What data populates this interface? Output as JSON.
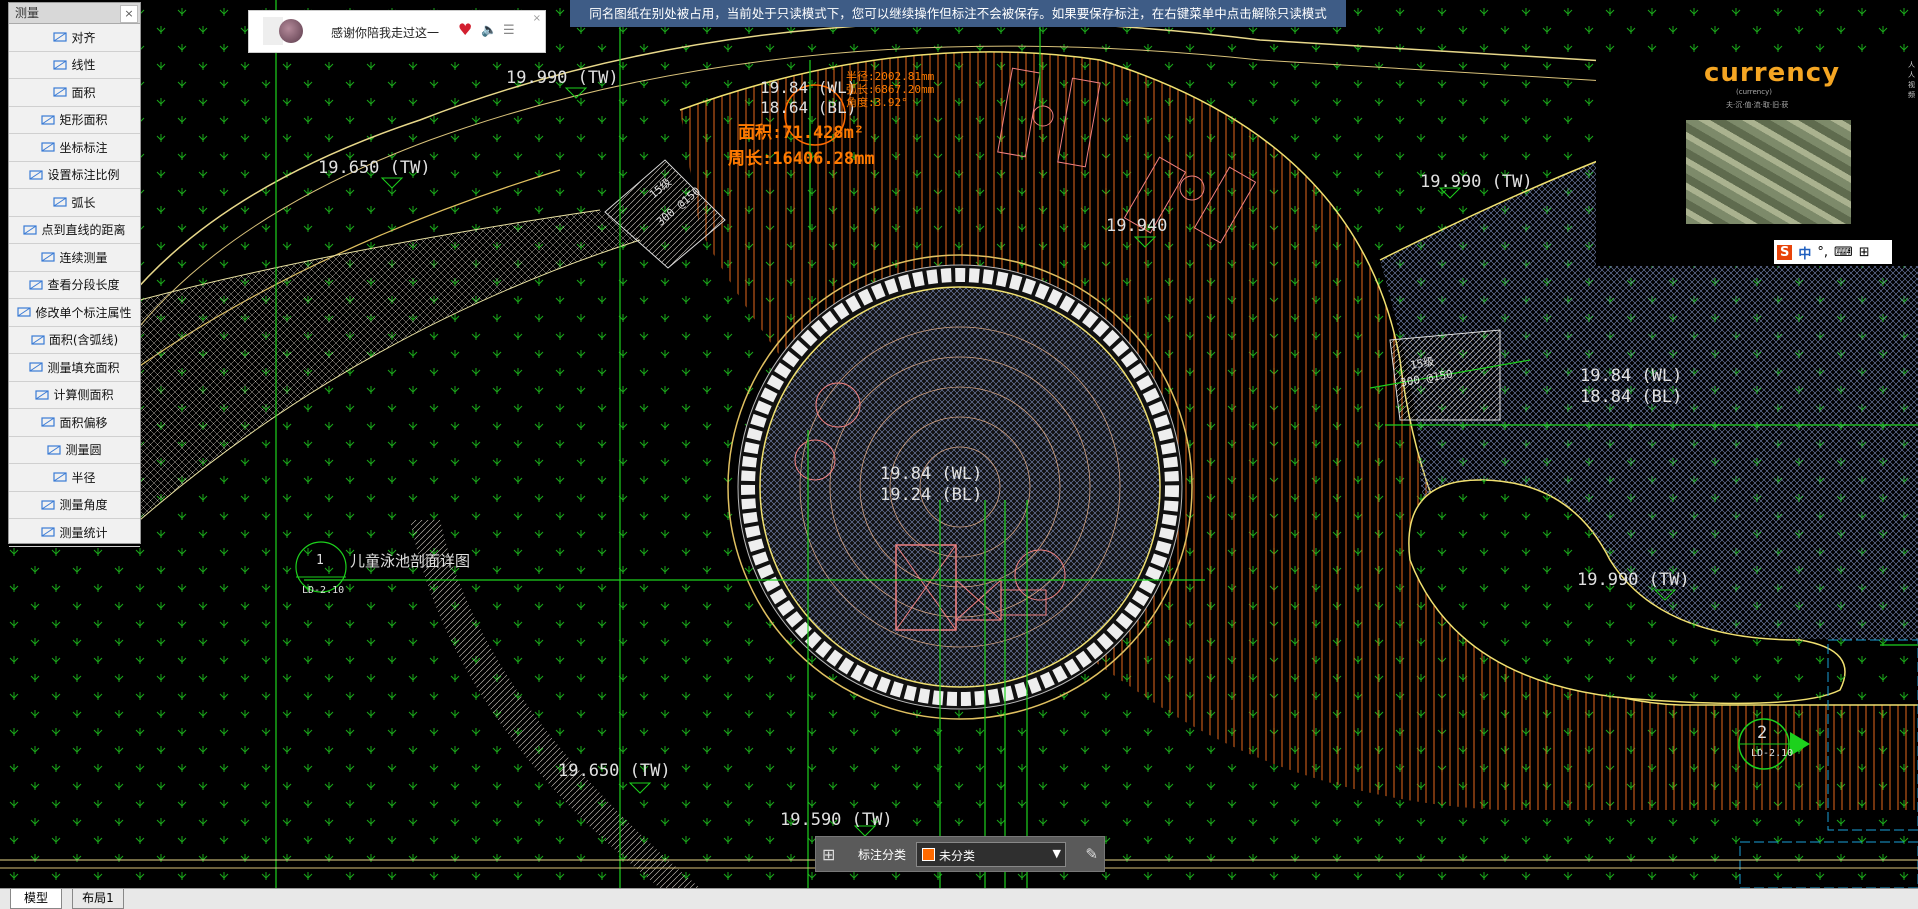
{
  "measure_panel": {
    "title": "测量",
    "close": "×",
    "tools": [
      {
        "label": "对齐",
        "icon": "align-icon"
      },
      {
        "label": "线性",
        "icon": "linear-icon"
      },
      {
        "label": "面积",
        "icon": "area-icon"
      },
      {
        "label": "矩形面积",
        "icon": "rect-area-icon"
      },
      {
        "label": "坐标标注",
        "icon": "coordinate-icon"
      },
      {
        "label": "设置标注比例",
        "icon": "scale-icon"
      },
      {
        "label": "弧长",
        "icon": "arc-icon"
      },
      {
        "label": "点到直线的距离",
        "icon": "point-line-icon"
      },
      {
        "label": "连续测量",
        "icon": "continuous-icon"
      },
      {
        "label": "查看分段长度",
        "icon": "segment-icon"
      },
      {
        "label": "修改单个标注属性",
        "icon": "edit-annotation-icon"
      },
      {
        "label": "面积(含弧线)",
        "icon": "arc-area-icon"
      },
      {
        "label": "测量填充面积",
        "icon": "hatch-area-icon"
      },
      {
        "label": "计算侧面积",
        "icon": "side-area-icon"
      },
      {
        "label": "面积偏移",
        "icon": "area-offset-icon"
      },
      {
        "label": "测量圆",
        "icon": "circle-icon"
      },
      {
        "label": "半径",
        "icon": "radius-icon"
      },
      {
        "label": "测量角度",
        "icon": "angle-icon"
      },
      {
        "label": "测量统计",
        "icon": "statistics-icon"
      }
    ]
  },
  "music_player": {
    "song": "感谢你陪我走过这一",
    "close": "×"
  },
  "readonly_notice": "同名图纸在别处被占用，当前处于只读模式下，您可以继续操作但标注不会被保存。如果要保存标注，在右键菜单中点击解除只读模式",
  "ad": {
    "title": "currency",
    "corner": "人人视频",
    "subtitle": "夫·沉·值·流·取·旧·获",
    "tagline": "(currency)"
  },
  "ime": {
    "s": "S",
    "zh": "中",
    "punct": "°,",
    "kb": "⌨",
    "menu": "⊞"
  },
  "drawing": {
    "labels": {
      "tw1": "19.990 (TW)",
      "tw2": "19.650 (TW)",
      "tw3": "19.990 (TW)",
      "tw4": "19.650 (TW)",
      "tw5": "19.590 (TW)",
      "tw6": "19.990 (TW)",
      "el1": "19.940",
      "wl_top": "19.84 (WL)",
      "bl_top": "18.64 (BL)",
      "wl_center": "19.84 (WL)",
      "bl_center": "19.24 (BL)",
      "wl_right": "19.84 (WL)",
      "bl_right": "18.84 (BL)",
      "section_title": "儿童泳池剖面详图",
      "section_num": "1",
      "section_ref": "LD-2.10",
      "section2_num": "2",
      "section2_ref": "LD-2.10",
      "step1": "15级",
      "step1b": "300 @150",
      "step2": "15级",
      "step2b": "300 @150",
      "measure_area": "面积:71.428m²",
      "measure_perimeter": "周长:16406.28mm",
      "measure_d1": "半径:2002.81mm",
      "measure_d2": "弧长:6867.20mm",
      "measure_d3": "角度:3.92°"
    }
  },
  "annotation_bar": {
    "label": "标注分类",
    "value": "未分类",
    "swatch_color": "#ff6a00"
  },
  "tabs": {
    "model": "模型",
    "layout": "布局1"
  }
}
